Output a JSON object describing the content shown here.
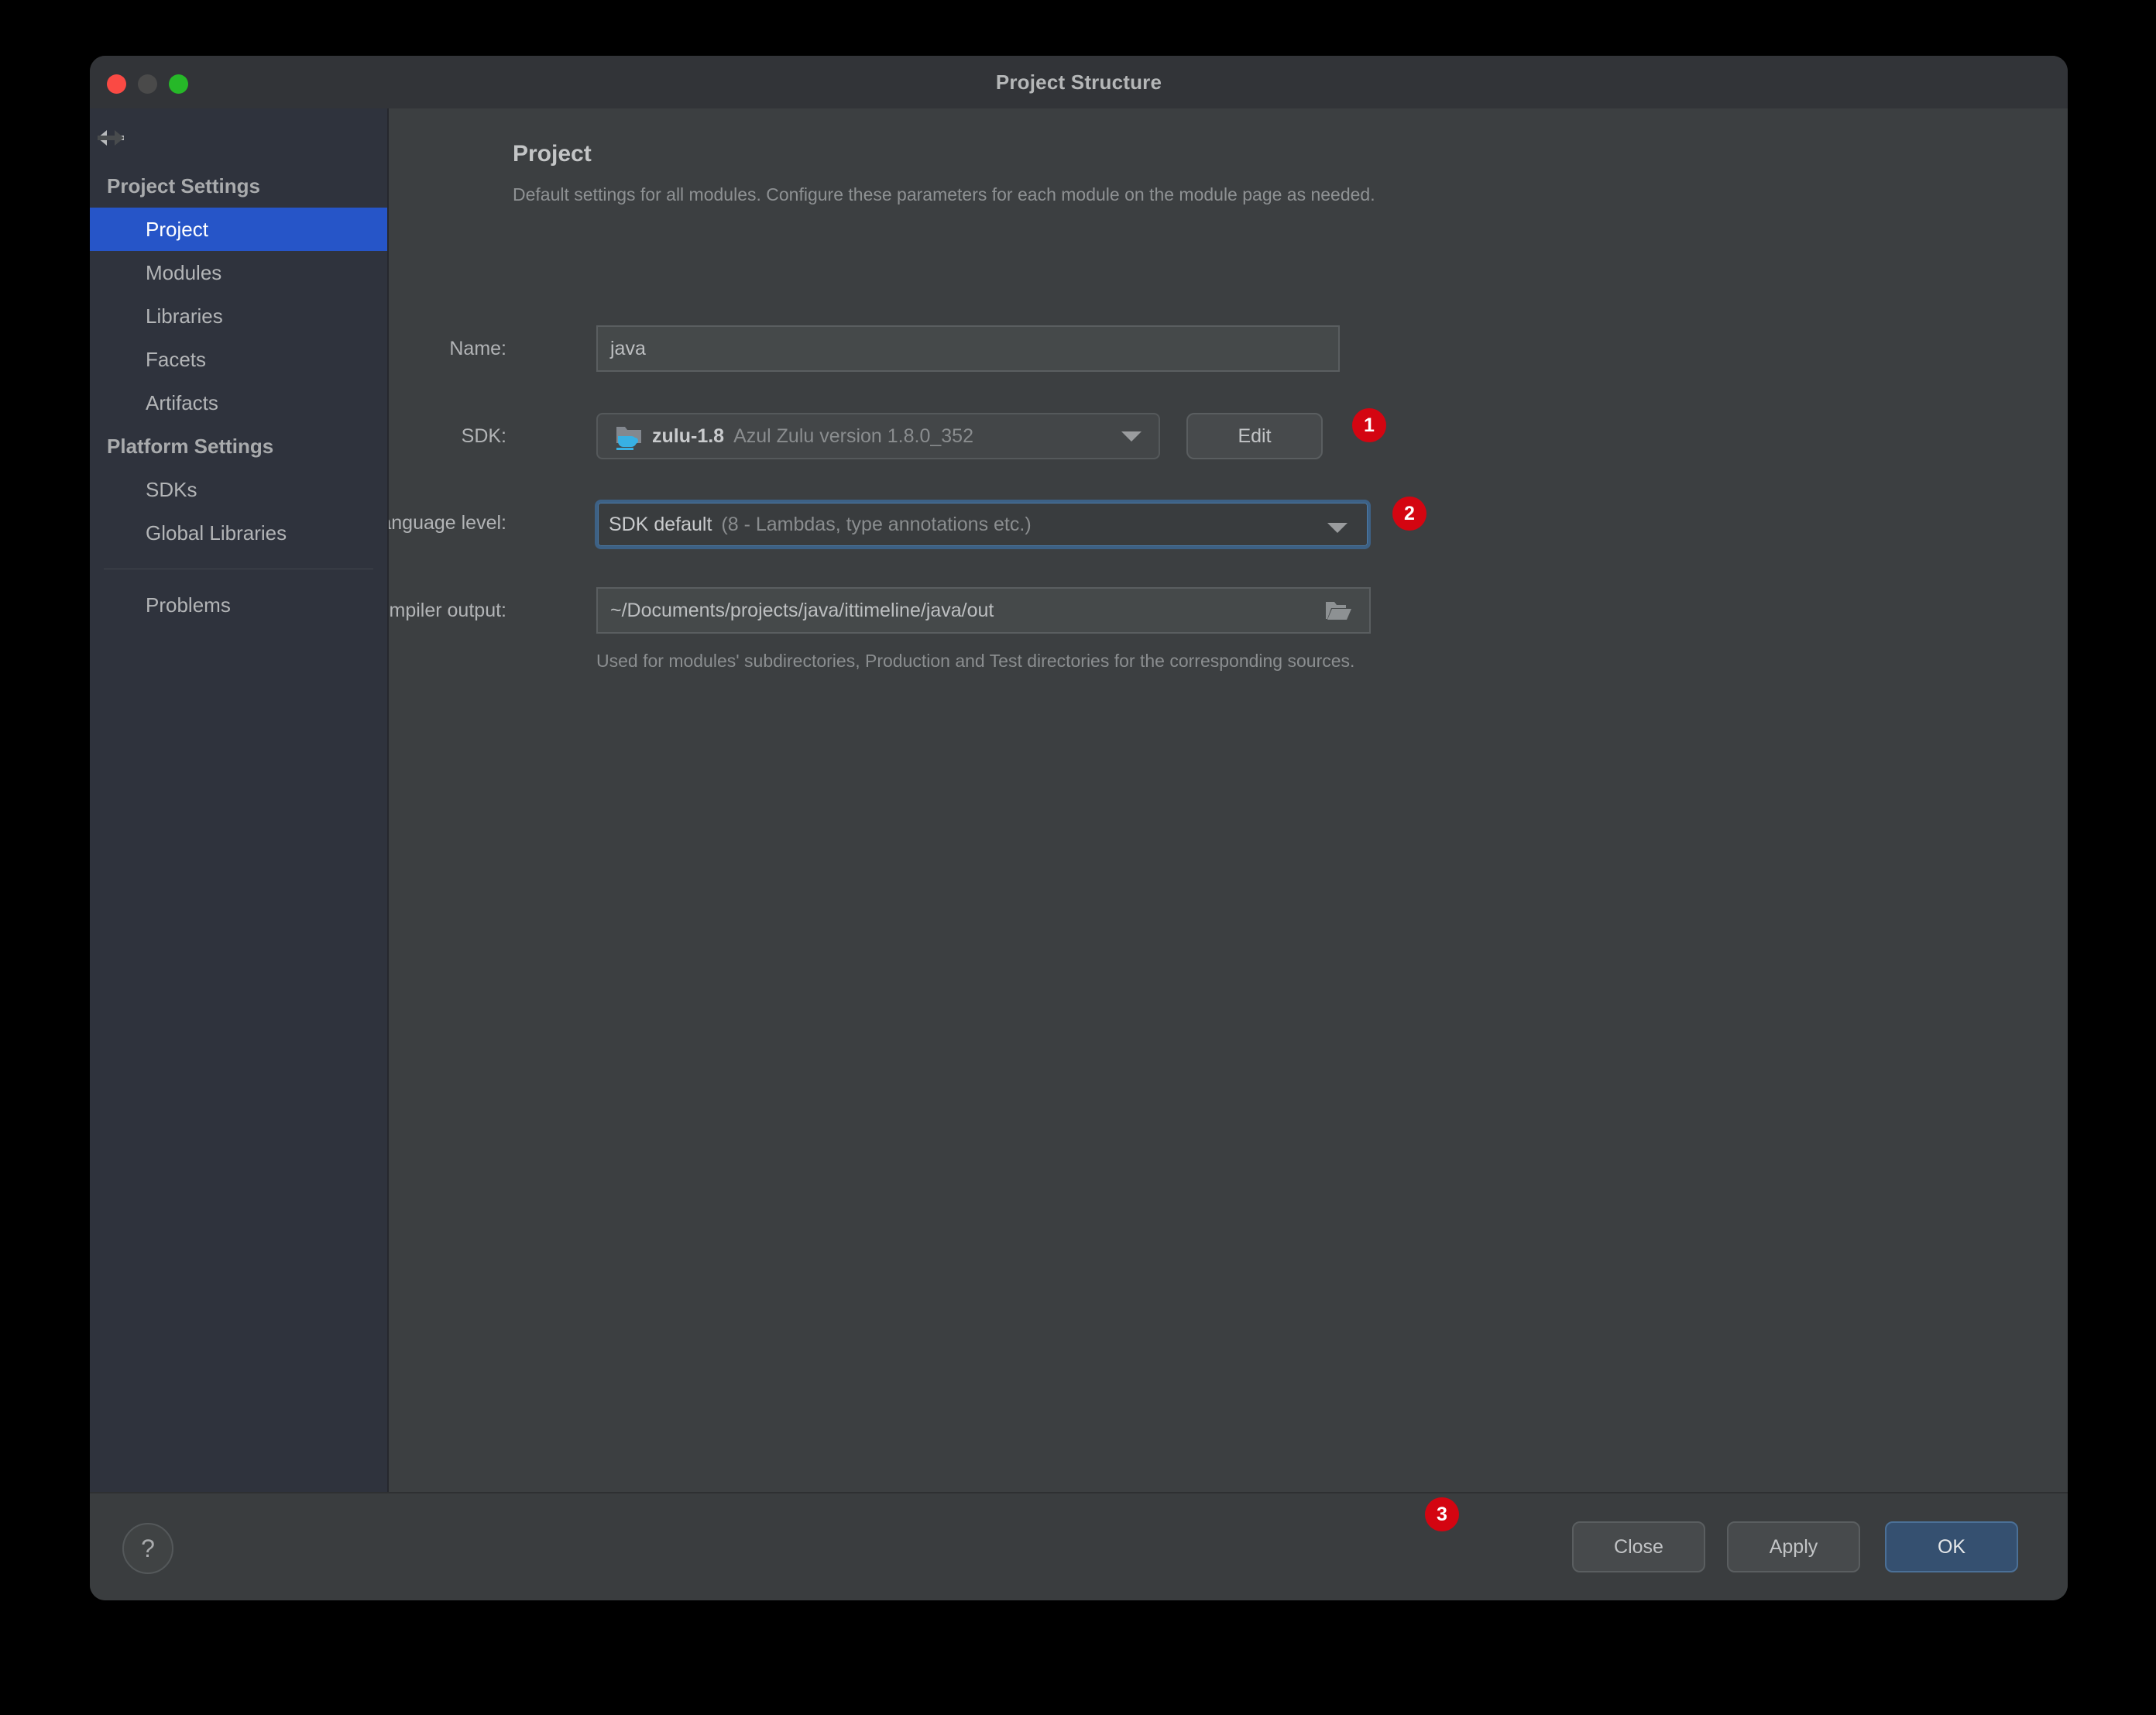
{
  "window": {
    "title": "Project Structure",
    "traffic_lights": [
      "close-red",
      "minimize-gray",
      "maximize-green"
    ]
  },
  "sidebar": {
    "nav": {
      "back_icon": "arrow-left-icon",
      "forward_icon": "arrow-right-icon"
    },
    "groups": [
      {
        "header": "Project Settings",
        "items": [
          {
            "label": "Project",
            "selected": true
          },
          {
            "label": "Modules",
            "selected": false
          },
          {
            "label": "Libraries",
            "selected": false
          },
          {
            "label": "Facets",
            "selected": false
          },
          {
            "label": "Artifacts",
            "selected": false
          }
        ]
      },
      {
        "header": "Platform Settings",
        "items": [
          {
            "label": "SDKs",
            "selected": false
          },
          {
            "label": "Global Libraries",
            "selected": false
          }
        ]
      }
    ],
    "problems_label": "Problems"
  },
  "main": {
    "title": "Project",
    "subtitle": "Default settings for all modules. Configure these parameters for each module on the module page as needed.",
    "name": {
      "label": "Name:",
      "value": "java",
      "placeholder": ""
    },
    "sdk": {
      "label": "SDK:",
      "icon": "java-sdk-folder-icon",
      "value": "zulu-1.8",
      "detail": "Azul Zulu version 1.8.0_352",
      "caret_icon": "chevron-down-icon",
      "edit_label": "Edit"
    },
    "language_level": {
      "label": "Language level:",
      "value": "SDK default",
      "detail": "(8 - Lambdas, type annotations etc.)",
      "caret_icon": "chevron-down-icon"
    },
    "compiler_output": {
      "label": "Compiler output:",
      "value": "~/Documents/projects/java/ittimeline/java/out",
      "browse_icon": "folder-open-icon",
      "helper": "Used for modules' subdirectories, Production and Test directories for the corresponding sources."
    }
  },
  "annotations": [
    {
      "number": "1",
      "target": "sdk-edit-button"
    },
    {
      "number": "2",
      "target": "language-level-combo"
    },
    {
      "number": "3",
      "target": "apply-button"
    }
  ],
  "footer": {
    "help_label": "?",
    "close_label": "Close",
    "apply_label": "Apply",
    "ok_label": "OK"
  },
  "colors": {
    "window_bg": "#3c3f41",
    "sidebar_bg": "#2f333d",
    "titlebar_bg": "#323438",
    "accent_selected": "#2655c8",
    "focus_border": "#4a7aa8",
    "ok_button_bg": "#355070",
    "badge_bg": "#d40511",
    "traffic_red": "#fa4a44",
    "traffic_gray": "#4a4a4a",
    "traffic_green": "#26b828"
  }
}
